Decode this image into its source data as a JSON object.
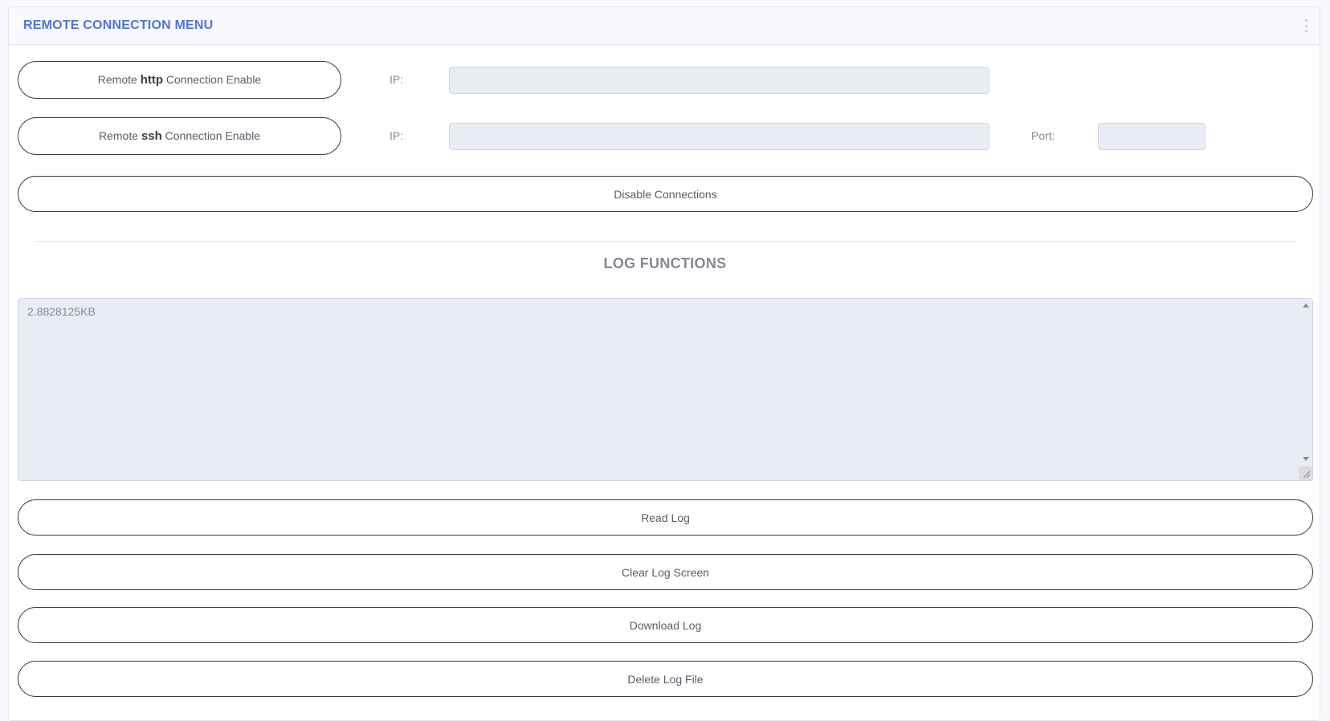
{
  "header": {
    "title": "REMOTE CONNECTION MENU",
    "menu_icon": "vertical-ellipsis-icon"
  },
  "connections": {
    "http_button": {
      "prefix": "Remote ",
      "protocol": "http",
      "suffix": " Connection Enable"
    },
    "http_ip_label": "IP:",
    "http_ip_value": "",
    "ssh_button": {
      "prefix": "Remote ",
      "protocol": "ssh",
      "suffix": " Connection Enable"
    },
    "ssh_ip_label": "IP:",
    "ssh_ip_value": "",
    "ssh_port_label": "Port:",
    "ssh_port_value": "",
    "disable_label": "Disable Connections"
  },
  "log": {
    "title": "LOG FUNCTIONS",
    "content": "2.8828125KB",
    "read_label": "Read Log",
    "clear_label": "Clear Log Screen",
    "download_label": "Download Log",
    "delete_label": "Delete Log File"
  },
  "colors": {
    "accent": "#4e73df",
    "input_bg": "#eaecf4",
    "button_border": "#3a3b45"
  }
}
